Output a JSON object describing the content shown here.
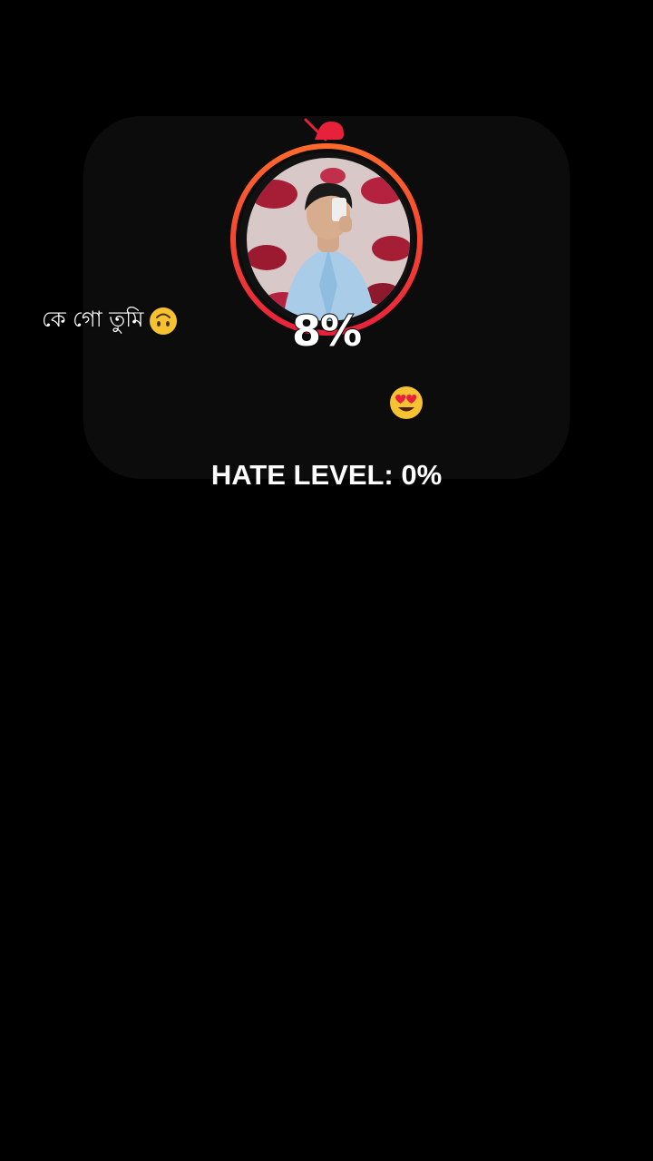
{
  "meter": {
    "percent_label": "8%",
    "value_percent": 8,
    "ring_color": "#e8213a",
    "ring_accent": "#ff6a2b"
  },
  "caption": {
    "text": "কে গো তুমি",
    "emoji": "upside-down-face-emoji"
  },
  "reaction": {
    "emoji": "smiling-face-with-heart-eyes-emoji"
  },
  "hate_level": {
    "label": "HATE LEVEL: 0%"
  },
  "icons": {
    "top": "muted-bell-icon"
  },
  "colors": {
    "background": "#000000",
    "card": "#0c0c0c",
    "accent": "#e8213a"
  }
}
